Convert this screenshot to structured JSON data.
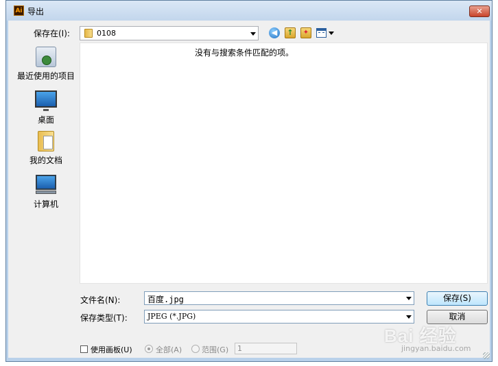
{
  "window": {
    "title": "导出",
    "app_icon_text": "Ai",
    "close_symbol": "✕"
  },
  "toolbar": {
    "save_in_label": "保存在(I):",
    "save_in_value": "0108",
    "icons": [
      "back-icon",
      "up-folder-icon",
      "new-folder-icon",
      "view-menu-icon"
    ]
  },
  "places": [
    {
      "label": "最近使用的项目",
      "icon": "recent-icon"
    },
    {
      "label": "桌面",
      "icon": "desktop-icon"
    },
    {
      "label": "我的文档",
      "icon": "documents-icon"
    },
    {
      "label": "计算机",
      "icon": "computer-icon"
    }
  ],
  "file_list": {
    "empty_message": "没有与搜索条件匹配的项。"
  },
  "fields": {
    "filename_label": "文件名(N):",
    "filename_value": "百度.jpg",
    "filetype_label": "保存类型(T):",
    "filetype_value": "JPEG (*.JPG)"
  },
  "buttons": {
    "save_label": "保存(S)",
    "cancel_label": "取消"
  },
  "options": {
    "artboard_label": "使用画板(U)",
    "artboard_checked": false,
    "all_label": "全部(A)",
    "range_label": "范围(G)",
    "range_value": "1"
  },
  "watermark": {
    "text": "Bai 经验",
    "sub": "jingyan.baidu.com"
  }
}
